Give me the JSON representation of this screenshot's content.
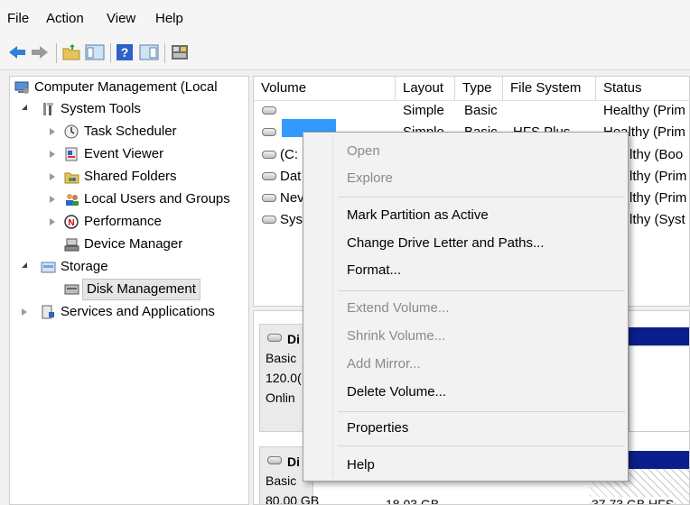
{
  "menubar": {
    "file": "File",
    "action": "Action",
    "view": "View",
    "help": "Help"
  },
  "tree": {
    "root": "Computer Management (Local",
    "system_tools": "System Tools",
    "task_scheduler": "Task Scheduler",
    "event_viewer": "Event Viewer",
    "shared_folders": "Shared Folders",
    "local_users": "Local Users and Groups",
    "performance": "Performance",
    "device_manager": "Device Manager",
    "storage": "Storage",
    "disk_management": "Disk Management",
    "services": "Services and Applications"
  },
  "volumes": {
    "headers": {
      "volume": "Volume",
      "layout": "Layout",
      "type": "Type",
      "fs": "File System",
      "status": "Status"
    },
    "rows": [
      {
        "volume": "",
        "layout": "Simple",
        "type": "Basic",
        "fs": "",
        "status": "Healthy (Prim"
      },
      {
        "volume": "",
        "layout": "Simple",
        "type": "Basic",
        "fs": "HFS Plus",
        "status": "Healthy (Prim"
      },
      {
        "volume": "(C:",
        "layout": "",
        "type": "",
        "fs": "",
        "status": "lthy (Boo"
      },
      {
        "volume": "Dat",
        "layout": "",
        "type": "",
        "fs": "",
        "status": "lthy (Prim"
      },
      {
        "volume": "Nev",
        "layout": "",
        "type": "",
        "fs": "",
        "status": "lthy (Prim"
      },
      {
        "volume": "Syst",
        "layout": "",
        "type": "",
        "fs": "",
        "status": "lthy (Syst"
      }
    ]
  },
  "disks": {
    "disk0": {
      "name": "Di",
      "kind": "Basic",
      "size": "120.0(",
      "state": "Onlin"
    },
    "disk1": {
      "name": "Di",
      "kind": "Basic",
      "size": "80.00 GB",
      "part_a": "18.03 GB",
      "part_b": "37.73 GB HFS"
    }
  },
  "context_menu": {
    "open": "Open",
    "explore": "Explore",
    "mark_active": "Mark Partition as Active",
    "change_letter": "Change Drive Letter and Paths...",
    "format": "Format...",
    "extend": "Extend Volume...",
    "shrink": "Shrink Volume...",
    "add_mirror": "Add Mirror...",
    "delete": "Delete Volume...",
    "properties": "Properties",
    "help": "Help"
  },
  "colors": {
    "selection": "#3399ff",
    "disk_bar": "#0b1f8c",
    "disabled_text": "#8a8a8a"
  }
}
